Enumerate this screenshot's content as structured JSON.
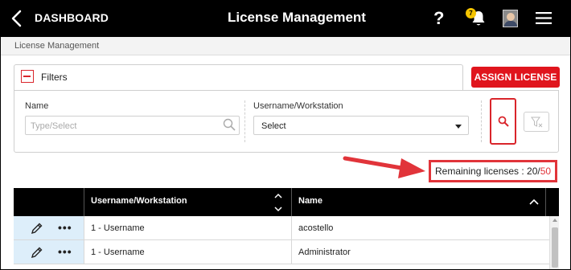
{
  "topbar": {
    "back_label": "DASHBOARD",
    "title": "License Management",
    "help": "?",
    "notification_count": "7",
    "icons": [
      "chevron-left-icon",
      "bell-icon",
      "avatar",
      "hamburger-menu-icon"
    ]
  },
  "breadcrumb": "License Management",
  "filters": {
    "label": "Filters",
    "name_label": "Name",
    "name_placeholder": "Type/Select",
    "user_label": "Username/Workstation",
    "user_select_value": "Select"
  },
  "assign_button": "ASSIGN LICENSE",
  "remaining": {
    "label": "Remaining licenses : 20/",
    "total": "50"
  },
  "table": {
    "headers": [
      "Username/Workstation",
      "Name"
    ],
    "rows": [
      {
        "user": "1 - Username",
        "name": "acostello"
      },
      {
        "user": "1 - Username",
        "name": "Administrator"
      }
    ],
    "row_actions": [
      "pencil-icon",
      "more-icon"
    ]
  },
  "colors": {
    "accent": "#e0151d",
    "topbar": "#000000",
    "annotation": "#e1343a",
    "action_cell": "#ddeefa"
  }
}
